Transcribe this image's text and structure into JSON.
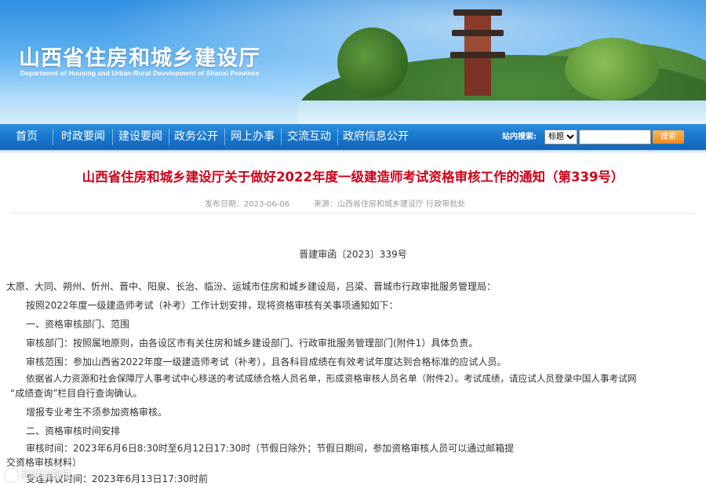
{
  "site": {
    "title_cn": "山西省住房和城乡建设厅",
    "title_en": "Department of Housing and Urban-Rural Development of Shanxi Province"
  },
  "nav": {
    "items": [
      "首页",
      "时政要闻",
      "建设要闻",
      "政务公开",
      "网上办事",
      "交流互动",
      "政府信息公开"
    ],
    "search_label": "站内搜索:",
    "search_option": "标题",
    "search_value": "",
    "search_button": "搜索"
  },
  "article": {
    "title": "山西省住房和城乡建设厅关于做好2022年度一级建造师考试资格审核工作的通知（第339号）",
    "date": "发布日期：2023-06-06",
    "source": "来源：山西省住房和城乡建设厅 行政审批处",
    "doc_no": "晋建审函〔2023〕339号",
    "paragraphs": [
      "太原、大同、朔州、忻州、晋中、阳泉、长治、临汾、运城市住房和城乡建设局，吕梁、晋城市行政审批服务管理局：",
      "按照2022年度一级建造师考试（补考）工作计划安排，现将资格审核有关事项通知如下：",
      "一、资格审核部门、范围",
      "审核部门：按照属地原则，由各设区市有关住房和城乡建设部门、行政审批服务管理部门(附件1）具体负责。",
      "审核范围：参加山西省2022年度一级建造师考试（补考），且各科目成绩在有效考试年度达到合格标准的应试人员。",
      "依据省人力资源和社会保障厅人事考试中心移送的考试成绩合格人员名单，形成资格审核人员名单（附件2）。考试成绩，请应试人员登录中国人事考试网",
      "“成绩查询”栏目自行查询确认。",
      "增报专业考生不须参加资格审核。",
      "二、资格审核时间安排",
      "审核时间：2023年6月6日8:30时至6月12日17:30时（节假日除外；节假日期间，参加资格审核人员可以通过邮箱提",
      "交资格审核材料）",
      "受理异议时间：2023年6月13日17:30时前"
    ]
  },
  "watermark": "北晚新视觉"
}
